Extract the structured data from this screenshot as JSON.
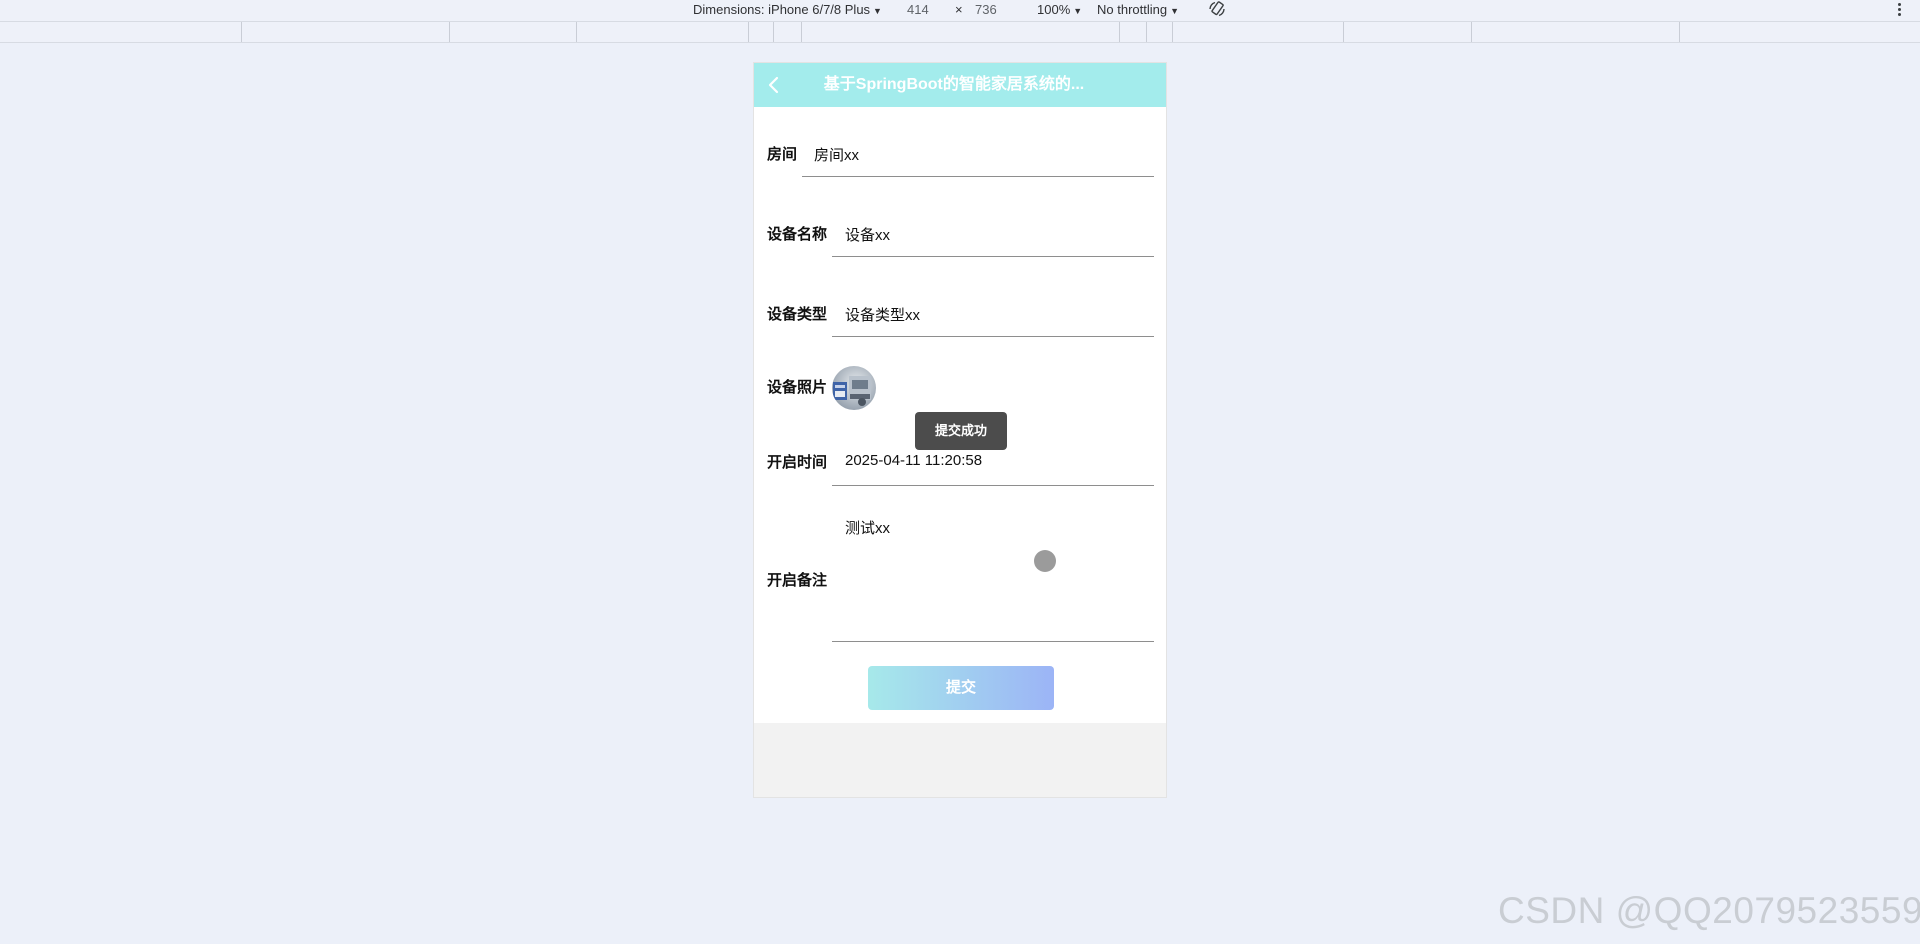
{
  "devtools": {
    "dimensions_label": "Dimensions: iPhone 6/7/8 Plus",
    "width": "414",
    "times": "×",
    "height": "736",
    "zoom": "100%",
    "throttling": "No throttling"
  },
  "app": {
    "header_title": "基于SpringBoot的智能家居系统的..."
  },
  "form": {
    "room_label": "房间",
    "room_value": "房间xx",
    "device_name_label": "设备名称",
    "device_name_value": "设备xx",
    "device_type_label": "设备类型",
    "device_type_value": "设备类型xx",
    "device_photo_label": "设备照片",
    "start_time_label": "开启时间",
    "start_time_value": "2025-04-11 11:20:58",
    "note_label": "开启备注",
    "note_value": "测试xx",
    "submit_label": "提交"
  },
  "toast": {
    "message": "提交成功"
  },
  "watermark": "CSDN @QQ2079523559",
  "colors": {
    "header_bg": "#a3ecec",
    "button_gradient_start": "#a6e9ea",
    "button_gradient_end": "#9cb4f6",
    "toast_bg": "#4c4c4c"
  },
  "icons": [
    "back-chevron-icon",
    "dropdown-caret-icon",
    "rotate-icon",
    "more-vertical-icon"
  ]
}
